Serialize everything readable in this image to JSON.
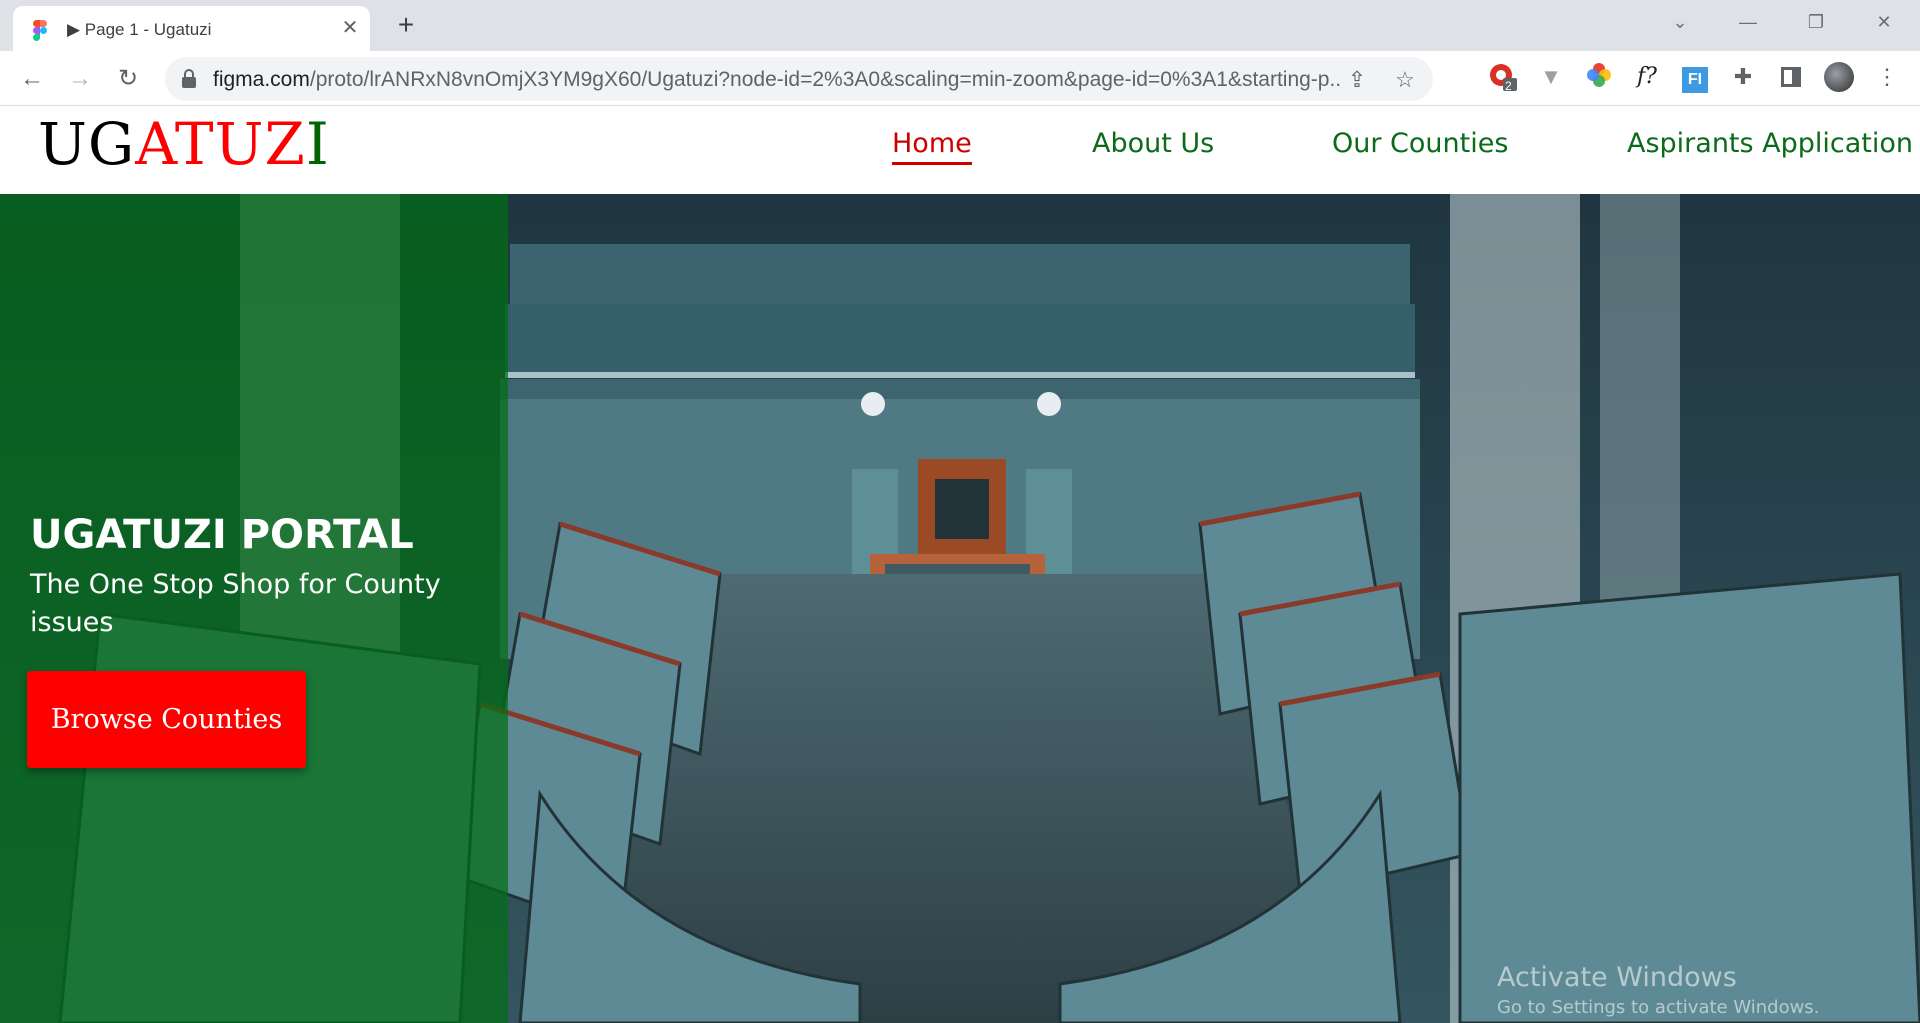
{
  "browser": {
    "tab_title": "▶ Page 1 - Ugatuzi",
    "tab_close": "✕",
    "new_tab": "+",
    "url_host": "figma.com",
    "url_path": "/proto/lrANRxN8vnOmjX3YM9gX60/Ugatuzi?node-id=2%3A0&scaling=min-zoom&page-id=0%3A1&starting-p...",
    "extension_badge": "2",
    "extension_f_label": "f?",
    "extension_fi_label": "FI"
  },
  "site": {
    "logo": {
      "part1": "UG",
      "part2": "ATUZ",
      "part3": "I"
    },
    "nav": [
      {
        "label": "Home",
        "active": true
      },
      {
        "label": "About Us",
        "active": false
      },
      {
        "label": "Our Counties",
        "active": false
      },
      {
        "label": "Aspirants Application",
        "active": false
      }
    ],
    "hero": {
      "heading": "UGATUZI PORTAL",
      "subheading": "The One Stop Shop for County issues",
      "cta_label": "Browse Counties"
    }
  },
  "os_watermark": {
    "line1": "Activate Windows",
    "line2": "Go to Settings to activate Windows."
  },
  "colors": {
    "logo_black": "#000000",
    "logo_red": "#ff0000",
    "logo_green": "#006400",
    "nav_green": "#0b6b1b",
    "nav_active_red": "#cc0000",
    "overlay_green": "#006e14",
    "cta_red": "#ff0000"
  }
}
